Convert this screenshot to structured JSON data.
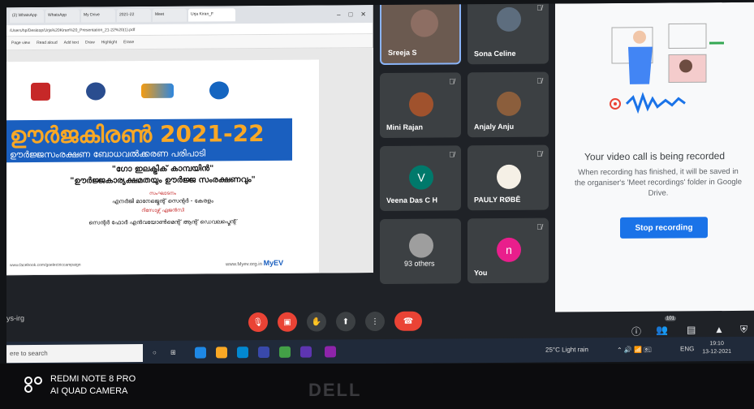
{
  "browser": {
    "tabs": [
      "(2) WhatsApp",
      "WhatsApp",
      "My Drive",
      "2021-22",
      "Meet",
      "Urja Kiran"
    ],
    "active_tab": "Urja Kiran_F",
    "address": "/Users/hp/Desktop/Urja%20Kiran%20_Presentation_21-22%20(1).pdf",
    "toolbar": [
      "Page view",
      "Read aloud",
      "Add text",
      "Draw",
      "Highlight",
      "Erase"
    ]
  },
  "slide": {
    "title": "ഊർജകിരൺ 2021-22",
    "subtitle": "ഊർജ്ജസംരക്ഷണ ബോധവൽക്കരണ പരിപാടി",
    "line1": "\"ഗോ ഇലക്ട്രിക് കാമ്പയിൻ\"",
    "line2": "\"ഊർജ്ജകാര്യക്ഷമതയും ഊർജ്ജ സംരക്ഷണവും\"",
    "line3": "സംഘാടനം",
    "line4": "എനർജി മാനേജ്മെന്റ് സെന്റർ - കേരളം",
    "line5": "റിസോഴ്സ് ഏജൻസി",
    "line6": "സെന്റർ ഫോർ എൻവയോൺമെന്റ് ആന്റ് ഡെവലപ്മെന്റ്",
    "footer_left": "www.facebook.com/goelectriccampaign",
    "footer_right": "www.Myev.org.in",
    "brand": "MyEV"
  },
  "participants": [
    {
      "name": "Sreeja S",
      "muted": false
    },
    {
      "name": "Sona Celine",
      "muted": true
    },
    {
      "name": "Mini Rajan",
      "muted": true
    },
    {
      "name": "Anjaly Anju",
      "muted": true
    },
    {
      "name": "Veena Das C H",
      "initial": "V",
      "muted": true
    },
    {
      "name": "PAULY RØBĒ",
      "muted": true
    },
    {
      "name": "93 others"
    },
    {
      "name": "You",
      "initial": "n",
      "muted": true
    }
  ],
  "recording": {
    "title": "Your video call is being recorded",
    "body": "When recording has finished, it will be saved in the organiser's 'Meet recordings' folder in Google Drive.",
    "button": "Stop recording"
  },
  "meeting_code": "ys-irg",
  "people_count": "101",
  "taskbar": {
    "search_placeholder": "ere to search",
    "weather": "25°C Light rain",
    "lang": "ENG",
    "time": "19:10",
    "date": "13-12-2021"
  },
  "watermark": {
    "line1": "REDMI NOTE 8 PRO",
    "line2": "AI QUAD CAMERA"
  },
  "monitor_brand": "DELL",
  "colors": {
    "meet_tile": "#3c4043",
    "end_call": "#ea4335",
    "stop_button": "#1a73e8",
    "slide_banner": "#1a5fbf"
  }
}
